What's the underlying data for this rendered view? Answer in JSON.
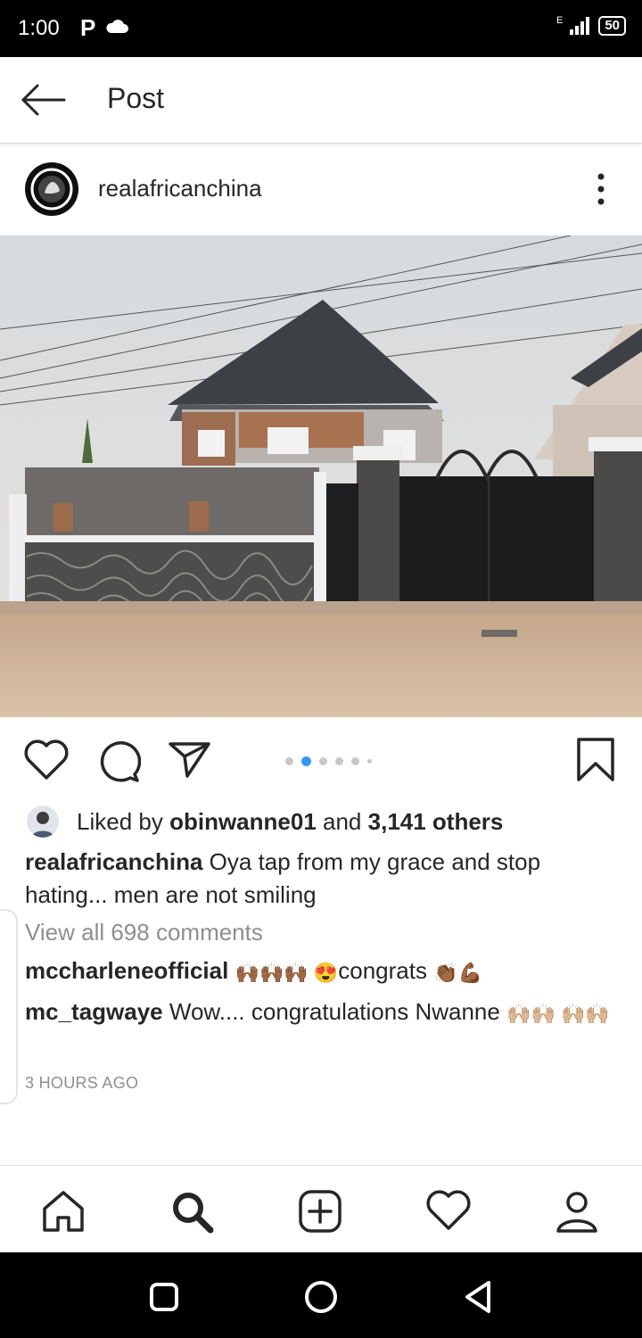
{
  "status_bar": {
    "time": "1:00",
    "p_icon": "P",
    "battery": "50",
    "signal_label": "E"
  },
  "header": {
    "title": "Post"
  },
  "post": {
    "username": "realafricanchina",
    "likes": {
      "prefix": "Liked by",
      "user": "obinwanne01",
      "and": "and",
      "count": "3,141 others"
    },
    "caption": {
      "user": "realafricanchina",
      "text": "Oya tap from my grace and stop hating... men are not smiling"
    },
    "view_all": "View all 698 comments",
    "comments": [
      {
        "user": "mccharleneofficial",
        "emoji_before": "🙌🏾🙌🏾🙌🏾 😍",
        "text": "congrats",
        "emoji_after": "👏🏾💪🏾"
      },
      {
        "user": "mc_tagwaye",
        "text": "Wow.... congratulations Nwanne",
        "emoji_after": "🙌🏼🙌🏼 🙌🏼🙌🏼"
      }
    ],
    "time_ago": "3 HOURS AGO"
  },
  "carousel": {
    "count": 5,
    "active_index": 1
  },
  "icons": [
    "back-arrow-icon",
    "more-vertical-icon",
    "heart-icon",
    "comment-icon",
    "share-icon",
    "bookmark-icon",
    "home-icon",
    "search-icon",
    "add-icon",
    "activity-heart-icon",
    "profile-icon"
  ],
  "colors": {
    "accent": "#3897f0",
    "muted": "#8e8e8e",
    "text": "#262626"
  }
}
